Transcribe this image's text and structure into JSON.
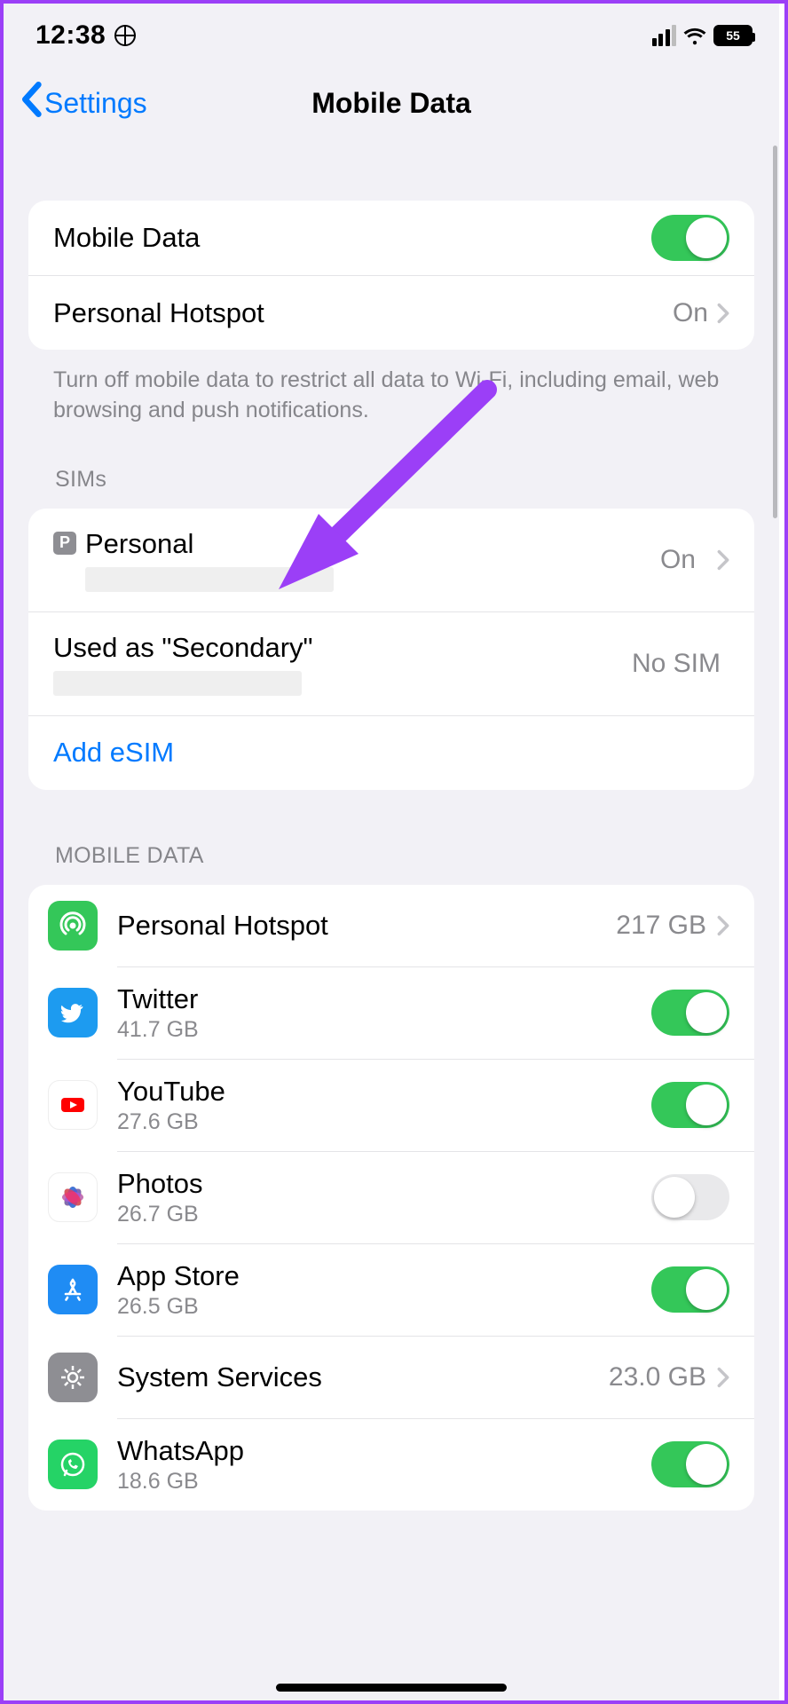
{
  "status": {
    "time": "12:38",
    "battery": "55"
  },
  "nav": {
    "back": "Settings",
    "title": "Mobile Data"
  },
  "group1": {
    "mobile_data_label": "Mobile Data",
    "hotspot_label": "Personal Hotspot",
    "hotspot_value": "On",
    "footer": "Turn off mobile data to restrict all data to Wi-Fi, including email, web browsing and push notifications."
  },
  "sims": {
    "header": "SIMs",
    "badge1": "P",
    "name1": "Personal",
    "value1": "On",
    "name2": "Used as \"Secondary\"",
    "value2": "No SIM",
    "add": "Add eSIM"
  },
  "apps": {
    "header": "MOBILE DATA",
    "items": [
      {
        "name": "Personal Hotspot",
        "usage": "",
        "value": "217 GB",
        "icon": "hotspot",
        "control": "chevron"
      },
      {
        "name": "Twitter",
        "usage": "41.7 GB",
        "icon": "twitter",
        "control": "toggle-on"
      },
      {
        "name": "YouTube",
        "usage": "27.6 GB",
        "icon": "youtube",
        "control": "toggle-on"
      },
      {
        "name": "Photos",
        "usage": "26.7 GB",
        "icon": "photos",
        "control": "toggle-off"
      },
      {
        "name": "App Store",
        "usage": "26.5 GB",
        "icon": "appstore",
        "control": "toggle-on"
      },
      {
        "name": "System Services",
        "usage": "",
        "value": "23.0 GB",
        "icon": "system",
        "control": "chevron"
      },
      {
        "name": "WhatsApp",
        "usage": "18.6 GB",
        "icon": "whatsapp",
        "control": "toggle-on"
      }
    ]
  },
  "colors": {
    "accent": "#007aff",
    "toggle_on": "#34c759",
    "annot_arrow": "#9b3ff7"
  }
}
